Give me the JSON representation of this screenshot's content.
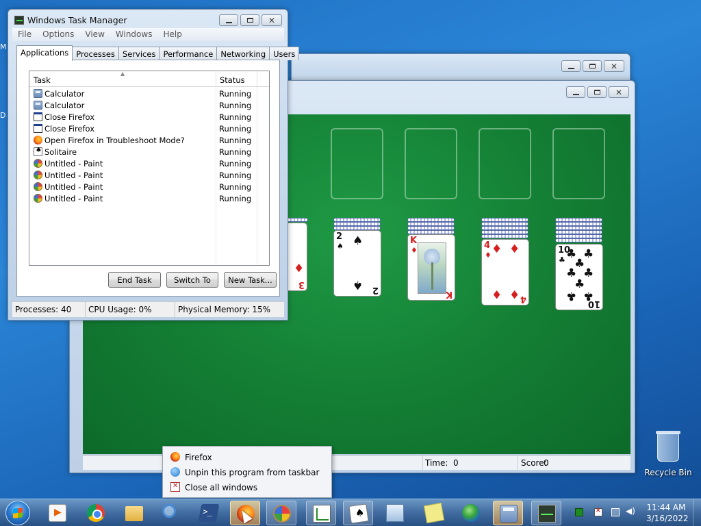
{
  "desktop": {
    "edge_letters": [
      "M",
      "D"
    ],
    "recycle_bin_label": "Recycle Bin"
  },
  "solitaire": {
    "time_label": "Time:",
    "time_value": "0",
    "score_label": "Score:",
    "score_value": "0",
    "tableau": [
      {
        "rank": "3",
        "suit": "♦"
      },
      {
        "rank": "2",
        "suit": "♠"
      },
      {
        "rank": "K",
        "suit": "♦"
      },
      {
        "rank": "4",
        "suit": "♦"
      },
      {
        "rank": "10",
        "suit": "♣"
      }
    ]
  },
  "taskmgr": {
    "title": "Windows Task Manager",
    "menu": [
      "File",
      "Options",
      "View",
      "Windows",
      "Help"
    ],
    "tabs": [
      "Applications",
      "Processes",
      "Services",
      "Performance",
      "Networking",
      "Users"
    ],
    "columns": {
      "task": "Task",
      "status": "Status"
    },
    "rows": [
      {
        "name": "Calculator",
        "status": "Running",
        "icon": "calculator-icon"
      },
      {
        "name": "Calculator",
        "status": "Running",
        "icon": "calculator-icon"
      },
      {
        "name": "Close Firefox",
        "status": "Running",
        "icon": "window-icon"
      },
      {
        "name": "Close Firefox",
        "status": "Running",
        "icon": "window-icon"
      },
      {
        "name": "Open Firefox in Troubleshoot Mode?",
        "status": "Running",
        "icon": "firefox-icon"
      },
      {
        "name": "Solitaire",
        "status": "Running",
        "icon": "solitaire-icon"
      },
      {
        "name": "Untitled - Paint",
        "status": "Running",
        "icon": "paint-icon"
      },
      {
        "name": "Untitled - Paint",
        "status": "Running",
        "icon": "paint-icon"
      },
      {
        "name": "Untitled - Paint",
        "status": "Running",
        "icon": "paint-icon"
      },
      {
        "name": "Untitled - Paint",
        "status": "Running",
        "icon": "paint-icon"
      }
    ],
    "buttons": {
      "end_task": "End Task",
      "switch_to": "Switch To",
      "new_task": "New Task..."
    },
    "status": {
      "processes": "Processes: 40",
      "cpu": "CPU Usage: 0%",
      "memory": "Physical Memory: 15%"
    }
  },
  "jump_menu": {
    "items": [
      {
        "label": "Firefox",
        "icon": "firefox-icon"
      },
      {
        "label": "Unpin this program from taskbar",
        "icon": "unpin-icon"
      },
      {
        "label": "Close all windows",
        "icon": "close-windows-icon"
      }
    ]
  },
  "taskbar": {
    "clock_time": "11:44 AM",
    "clock_date": "3/16/2022"
  }
}
